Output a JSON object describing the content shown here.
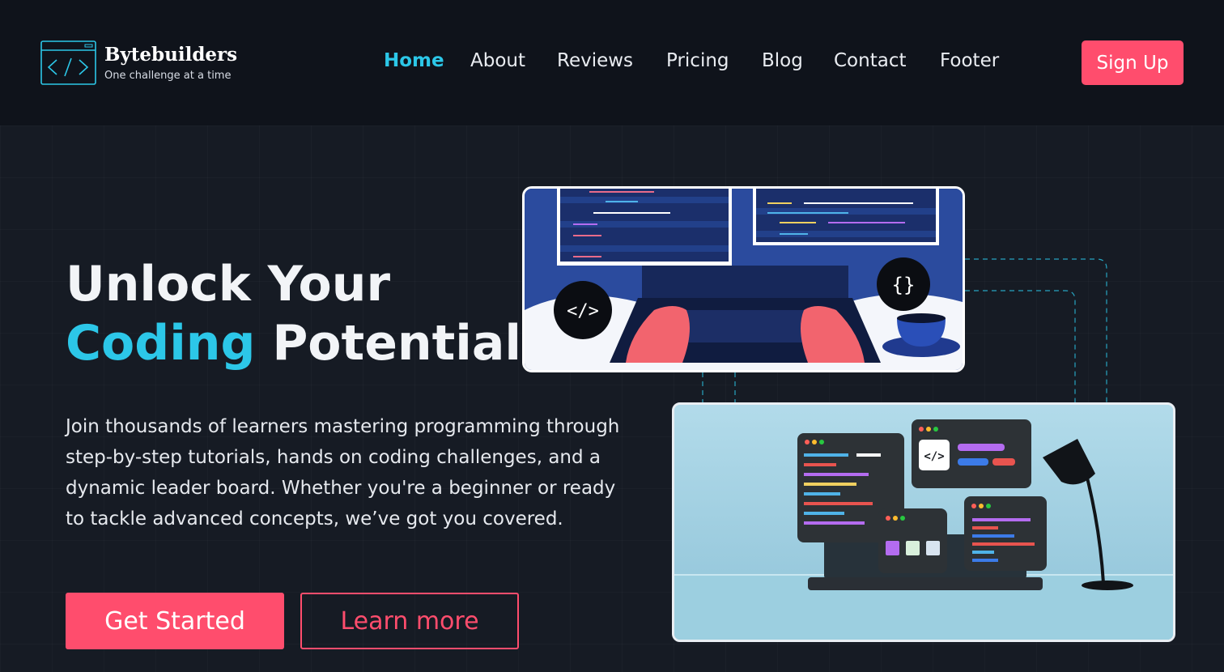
{
  "brand": {
    "name": "Bytebuilders",
    "tagline": "One challenge at a time"
  },
  "nav": {
    "items": [
      {
        "label": "Home",
        "active": true
      },
      {
        "label": "About",
        "active": false
      },
      {
        "label": "Reviews",
        "active": false
      },
      {
        "label": "Pricing",
        "active": false
      },
      {
        "label": "Blog",
        "active": false
      },
      {
        "label": "Contact",
        "active": false
      },
      {
        "label": "Footer",
        "active": false
      }
    ],
    "signup_label": "Sign Up"
  },
  "hero": {
    "headline_line1": "Unlock Your",
    "headline_accent": "Coding",
    "headline_line2_rest": " Potential",
    "description": "Join thousands of learners mastering programming through step-by-step tutorials, hands on coding challenges, and a dynamic leader board. Whether you're a beginner or ready to tackle advanced concepts, we’ve got you covered.",
    "primary_cta": "Get Started",
    "secondary_cta": "Learn more"
  },
  "images": {
    "illustration1": {
      "code_glyph": "</>",
      "braces_glyph": "{}"
    },
    "illustration2": {
      "code_glyph": "</>"
    }
  },
  "colors": {
    "accent_cyan": "#2cc7e8",
    "accent_pink": "#ff4d6d",
    "nav_bg": "#0f131b",
    "page_bg": "#161b24"
  }
}
